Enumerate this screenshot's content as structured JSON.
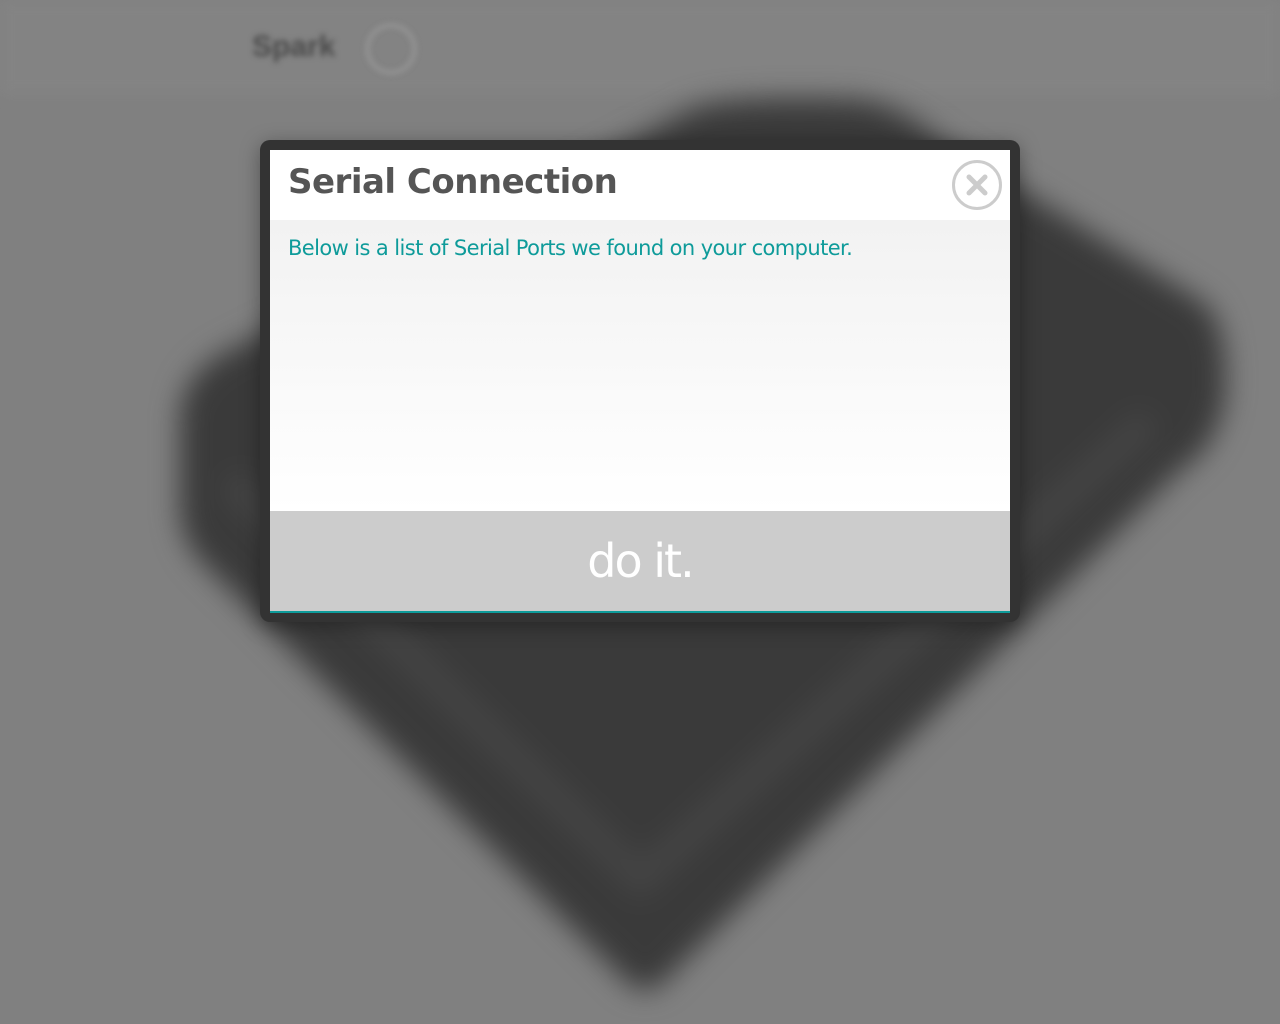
{
  "background": {
    "logo_text": "Spark"
  },
  "modal": {
    "title": "Serial Connection",
    "description": "Below is a list of Serial Ports we found on your computer.",
    "ports": [],
    "submit_label": "do it.",
    "close_icon": "close-circle-icon"
  },
  "colors": {
    "accent": "#0e9b9a",
    "title": "#555555",
    "button_bg": "#cccccc",
    "frame": "#333333",
    "overlay": "#808080"
  }
}
